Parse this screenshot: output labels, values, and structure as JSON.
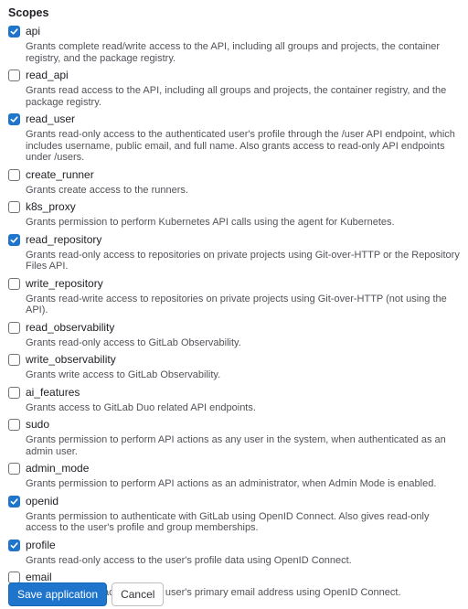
{
  "scopes_heading": "Scopes",
  "scopes": [
    {
      "name": "api",
      "checked": true,
      "description": "Grants complete read/write access to the API, including all groups and projects, the container registry, and the package registry."
    },
    {
      "name": "read_api",
      "checked": false,
      "description": "Grants read access to the API, including all groups and projects, the container registry, and the package registry."
    },
    {
      "name": "read_user",
      "checked": true,
      "description": "Grants read-only access to the authenticated user's profile through the /user API endpoint, which includes username, public email, and full name. Also grants access to read-only API endpoints under /users."
    },
    {
      "name": "create_runner",
      "checked": false,
      "description": "Grants create access to the runners."
    },
    {
      "name": "k8s_proxy",
      "checked": false,
      "description": "Grants permission to perform Kubernetes API calls using the agent for Kubernetes."
    },
    {
      "name": "read_repository",
      "checked": true,
      "description": "Grants read-only access to repositories on private projects using Git-over-HTTP or the Repository Files API."
    },
    {
      "name": "write_repository",
      "checked": false,
      "description": "Grants read-write access to repositories on private projects using Git-over-HTTP (not using the API)."
    },
    {
      "name": "read_observability",
      "checked": false,
      "description": "Grants read-only access to GitLab Observability."
    },
    {
      "name": "write_observability",
      "checked": false,
      "description": "Grants write access to GitLab Observability."
    },
    {
      "name": "ai_features",
      "checked": false,
      "description": "Grants access to GitLab Duo related API endpoints."
    },
    {
      "name": "sudo",
      "checked": false,
      "description": "Grants permission to perform API actions as any user in the system, when authenticated as an admin user."
    },
    {
      "name": "admin_mode",
      "checked": false,
      "description": "Grants permission to perform API actions as an administrator, when Admin Mode is enabled."
    },
    {
      "name": "openid",
      "checked": true,
      "description": "Grants permission to authenticate with GitLab using OpenID Connect. Also gives read-only access to the user's profile and group memberships."
    },
    {
      "name": "profile",
      "checked": true,
      "description": "Grants read-only access to the user's profile data using OpenID Connect."
    },
    {
      "name": "email",
      "checked": false,
      "description": "Grants read-only access to the user's primary email address using OpenID Connect."
    }
  ],
  "actions": {
    "save_label": "Save application",
    "cancel_label": "Cancel"
  },
  "colors": {
    "checkbox_checked": "#1f75cb",
    "primary_button": "#1f75cb"
  }
}
